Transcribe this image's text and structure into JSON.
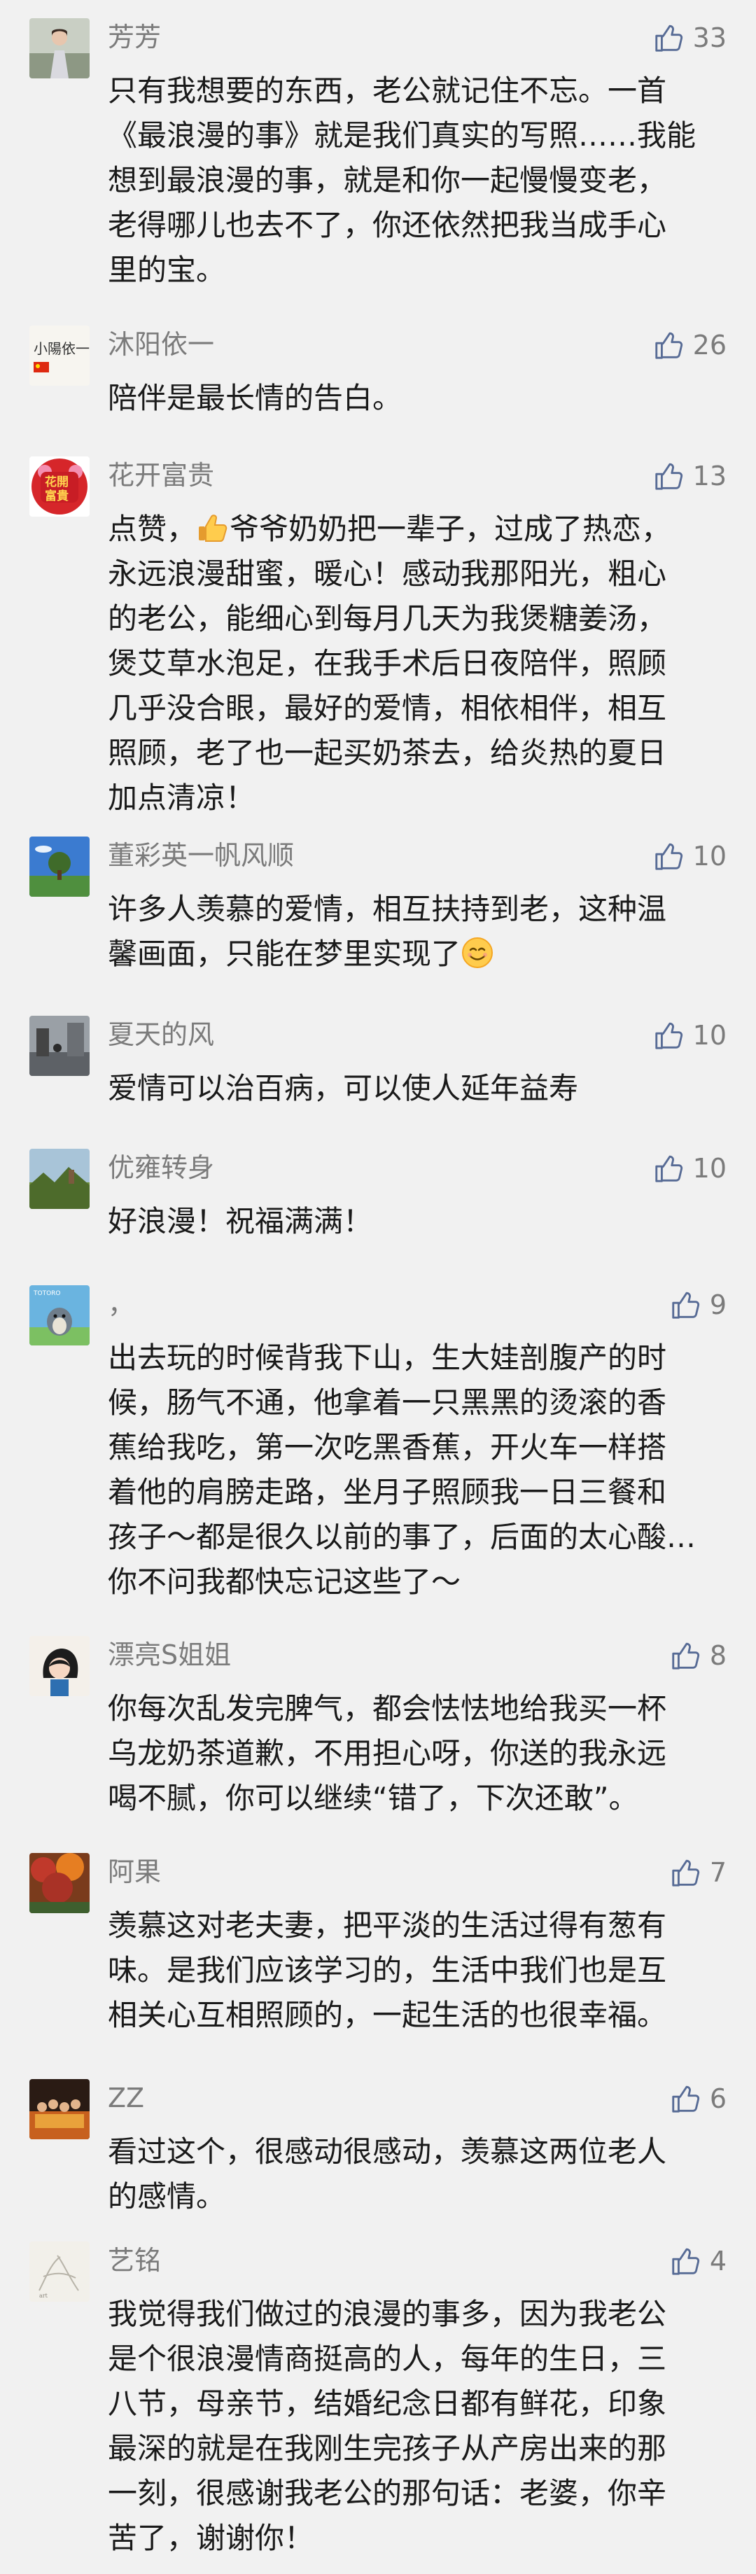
{
  "comments": [
    {
      "nickname": "芳芳",
      "likes": "33",
      "avatar_icon": "woman-portrait-avatar",
      "lines": [
        "只有我想要的东西，老公就记住不忘。一首",
        "《最浪漫的事》就是我们真实的写照……我能",
        "想到最浪漫的事，就是和你一起慢慢变老，",
        "老得哪儿也去不了，你还依然把我当成手心",
        "里的宝。"
      ]
    },
    {
      "nickname": "沐阳依一",
      "likes": "26",
      "avatar_icon": "calligraphy-flag-avatar",
      "lines": [
        "陪伴是最长情的告白。"
      ]
    },
    {
      "nickname": "花开富贵",
      "likes": "13",
      "avatar_icon": "flower-fortune-avatar",
      "lines": [
        "点赞，[thumb]爷爷奶奶把一辈子，过成了热恋，",
        "永远浪漫甜蜜，暖心！感动我那阳光，粗心",
        "的老公，能细心到每月几天为我煲糖姜汤，",
        "煲艾草水泡足，在我手术后日夜陪伴，照顾",
        "几乎没合眼，最好的爱情，相依相伴，相互",
        "照顾，老了也一起买奶茶去，给炎热的夏日",
        "加点清凉！"
      ]
    },
    {
      "nickname": "董彩英一帆风顺",
      "likes": "10",
      "avatar_icon": "sky-tree-avatar",
      "lines": [
        "许多人羡慕的爱情，相互扶持到老，这种温",
        "馨画面，只能在梦里实现了[smile]"
      ]
    },
    {
      "nickname": "夏天的风",
      "likes": "10",
      "avatar_icon": "street-scene-avatar",
      "lines": [
        "爱情可以治百病，可以使人延年益寿"
      ]
    },
    {
      "nickname": "优雍转身",
      "likes": "10",
      "avatar_icon": "landscape-avatar",
      "lines": [
        "好浪漫！祝福满满！"
      ]
    },
    {
      "nickname": "，",
      "likes": "9",
      "avatar_icon": "cartoon-totoro-avatar",
      "lines": [
        "出去玩的时候背我下山，生大娃剖腹产的时",
        "候，肠气不通，他拿着一只黑黑的烫滚的香",
        "蕉给我吃，第一次吃黑香蕉，开火车一样搭",
        "着他的肩膀走路，坐月子照顾我一日三餐和",
        "孩子～都是很久以前的事了，后面的太心酸…",
        "你不问我都快忘记这些了～"
      ]
    },
    {
      "nickname": "漂亮S姐姐",
      "likes": "8",
      "avatar_icon": "cartoon-girl-avatar",
      "lines": [
        "你每次乱发完脾气，都会怯怯地给我买一杯",
        "乌龙奶茶道歉，不用担心呀，你送的我永远",
        "喝不腻，你可以继续“错了，下次还敢”。"
      ]
    },
    {
      "nickname": "阿果",
      "likes": "7",
      "avatar_icon": "autumn-tree-avatar",
      "lines": [
        "羡慕这对老夫妻，把平淡的生活过得有葱有",
        "味。是我们应该学习的，生活中我们也是互",
        "相关心互相照顾的，一起生活的也很幸福。"
      ]
    },
    {
      "nickname": "ZZ",
      "likes": "6",
      "avatar_icon": "group-photo-avatar",
      "lines": [
        "看过这个，很感动很感动，羡慕这两位老人",
        "的感情。"
      ]
    },
    {
      "nickname": "艺铭",
      "likes": "4",
      "avatar_icon": "sketch-avatar",
      "lines": [
        "我觉得我们做过的浪漫的事多，因为我老公",
        "是个很浪漫情商挺高的人，每年的生日，三",
        "八节，母亲节，结婚纪念日都有鲜花，印象",
        "最深的就是在我刚生完孩子从产房出来的那",
        "一刻，很感谢我老公的那句话：老婆，你辛",
        "苦了，谢谢你！"
      ]
    }
  ],
  "icons": {
    "like": "thumbs-up-outline-icon",
    "inline_thumb": "thumbs-up-emoji",
    "inline_smile": "smile-emoji"
  },
  "colors": {
    "background": "#f1f1f1",
    "nickname": "#7b7b7b",
    "content": "#1a1a1a",
    "like_icon": "#576b95"
  }
}
